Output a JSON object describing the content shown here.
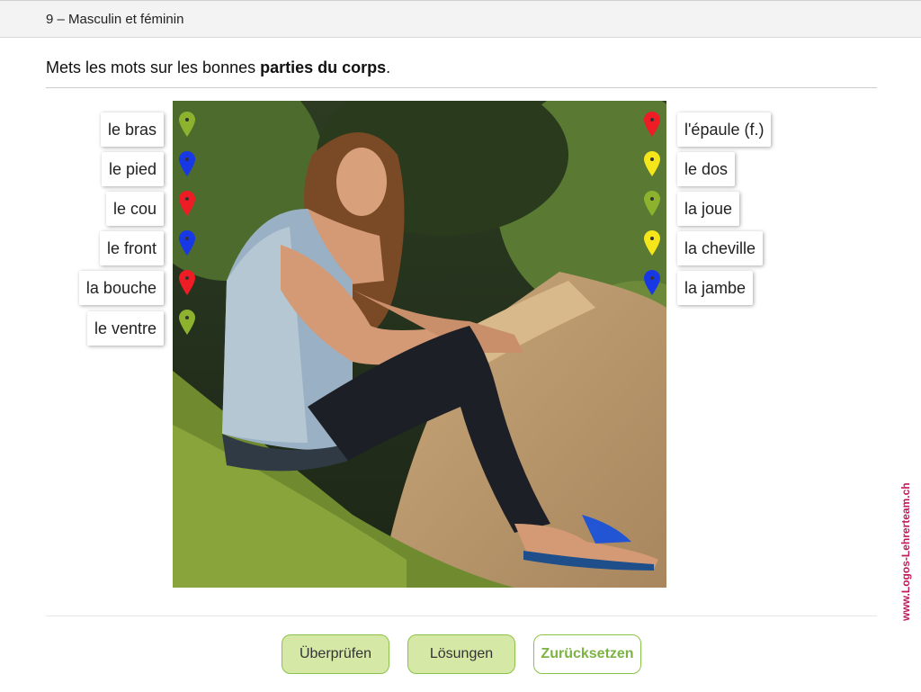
{
  "header": {
    "title": "9 – Masculin et féminin"
  },
  "instruction": {
    "text_before": "Mets les mots sur les bonnes ",
    "bold": "parties du corps",
    "text_after": "."
  },
  "labels_left": [
    {
      "text": "le bras",
      "pin_color": "#8db32e"
    },
    {
      "text": "le pied",
      "pin_color": "#1838e6"
    },
    {
      "text": "le cou",
      "pin_color": "#ee1c25"
    },
    {
      "text": "le front",
      "pin_color": "#1838e6"
    },
    {
      "text": "la bouche",
      "pin_color": "#ee1c25"
    },
    {
      "text": "le ventre",
      "pin_color": "#8db32e"
    }
  ],
  "labels_right": [
    {
      "text": "l'épaule (f.)",
      "pin_color": "#ee1c25"
    },
    {
      "text": "le dos",
      "pin_color": "#f5e51b"
    },
    {
      "text": "la joue",
      "pin_color": "#8db32e"
    },
    {
      "text": "la cheville",
      "pin_color": "#f5e51b"
    },
    {
      "text": "la jambe",
      "pin_color": "#1838e6"
    }
  ],
  "buttons": {
    "check": "Überprüfen",
    "solutions": "Lösungen",
    "reset": "Zurücksetzen"
  },
  "watermark": "www.Logos-Lehrerteam.ch",
  "colors": {
    "accent": "#8bc34a",
    "watermark": "#c2185b"
  }
}
